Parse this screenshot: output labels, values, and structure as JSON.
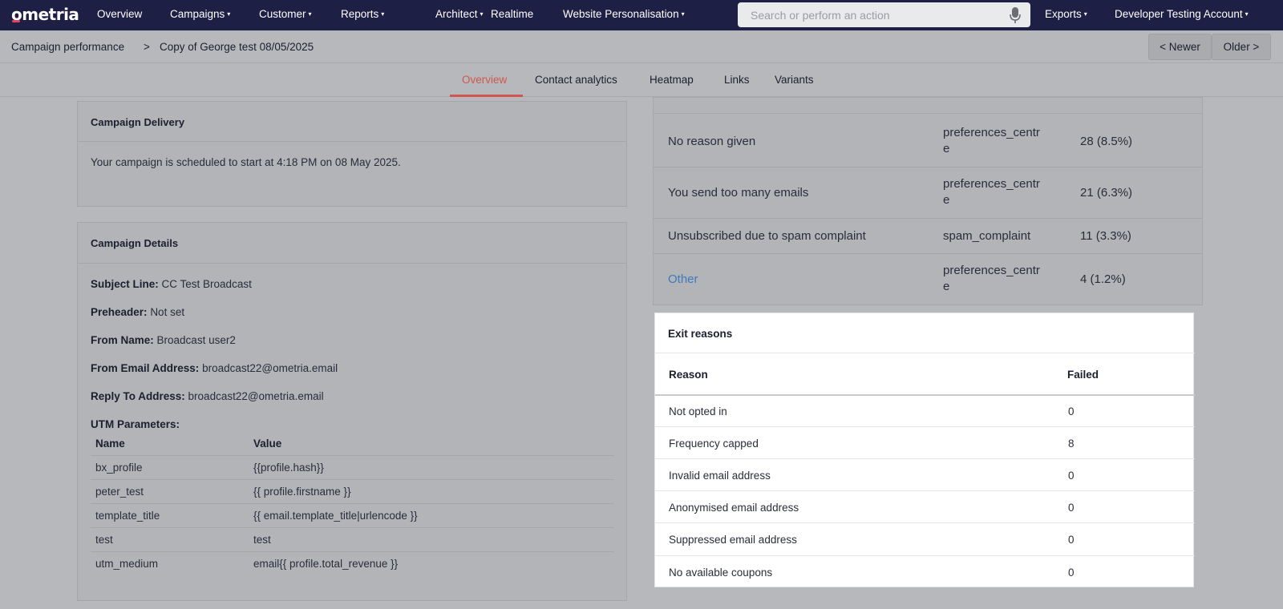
{
  "app": {
    "logo_text": "ometria"
  },
  "nav": {
    "items": [
      {
        "label": "Overview",
        "dropdown": false
      },
      {
        "label": "Campaigns",
        "dropdown": true
      },
      {
        "label": "Customer",
        "dropdown": true
      },
      {
        "label": "Reports",
        "dropdown": true
      },
      {
        "label": "Architect",
        "dropdown": true
      },
      {
        "label": "Realtime",
        "dropdown": false
      },
      {
        "label": "Website Personalisation",
        "dropdown": true
      }
    ],
    "search_placeholder": "Search or perform an action",
    "exports_label": "Exports",
    "account_label": "Developer Testing Account",
    "caret": "▾"
  },
  "breadcrumb": {
    "parent": "Campaign performance",
    "separator": ">",
    "current": "Copy of George test 08/05/2025"
  },
  "pager": {
    "newer": "< Newer",
    "older": "Older >"
  },
  "tabs": [
    {
      "label": "Overview",
      "active": true
    },
    {
      "label": "Contact analytics",
      "active": false
    },
    {
      "label": "Heatmap",
      "active": false
    },
    {
      "label": "Links",
      "active": false
    },
    {
      "label": "Variants",
      "active": false
    }
  ],
  "delivery": {
    "title": "Campaign Delivery",
    "message": "Your campaign is scheduled to start at 4:18 PM on 08 May 2025."
  },
  "details": {
    "title": "Campaign Details",
    "fields": [
      {
        "label": "Subject Line:",
        "value": "CC Test Broadcast"
      },
      {
        "label": "Preheader:",
        "value": "Not set"
      },
      {
        "label": "From Name:",
        "value": "Broadcast user2"
      },
      {
        "label": "From Email Address:",
        "value": "broadcast22@ometria.email"
      },
      {
        "label": "Reply To Address:",
        "value": "broadcast22@ometria.email"
      }
    ],
    "utm_label": "UTM Parameters:",
    "utm_headers": {
      "name": "Name",
      "value": "Value"
    },
    "utm_rows": [
      {
        "name": "bx_profile",
        "value": "{{profile.hash}}"
      },
      {
        "name": "peter_test",
        "value": "{{ profile.firstname }}"
      },
      {
        "name": "template_title",
        "value": "{{ email.template_title|urlencode }}"
      },
      {
        "name": "test",
        "value": "test"
      },
      {
        "name": "utm_medium",
        "value": "email{{ profile.total_revenue }}"
      }
    ]
  },
  "unsubscribe_reasons": {
    "rows": [
      {
        "reason": "No reason given",
        "source_line1": "preferences_centr",
        "source_line2": "e",
        "count": "28 (8.5%)",
        "link": false
      },
      {
        "reason": "You send too many emails",
        "source_line1": "preferences_centr",
        "source_line2": "e",
        "count": "21 (6.3%)",
        "link": false
      },
      {
        "reason": "Unsubscribed due to spam complaint",
        "source_line1": "spam_complaint",
        "source_line2": "",
        "count": "11 (3.3%)",
        "link": false
      },
      {
        "reason": "Other",
        "source_line1": "preferences_centr",
        "source_line2": "e",
        "count": "4 (1.2%)",
        "link": true
      }
    ]
  },
  "exit_reasons": {
    "title": "Exit reasons",
    "headers": {
      "reason": "Reason",
      "failed": "Failed"
    },
    "rows": [
      {
        "reason": "Not opted in",
        "failed": "0"
      },
      {
        "reason": "Frequency capped",
        "failed": "8"
      },
      {
        "reason": "Invalid email address",
        "failed": "0"
      },
      {
        "reason": "Anonymised email address",
        "failed": "0"
      },
      {
        "reason": "Suppressed email address",
        "failed": "0"
      },
      {
        "reason": "No available coupons",
        "failed": "0"
      }
    ]
  },
  "colors": {
    "nav_bg": "#1d1f44",
    "accent_tab": "#d0574f",
    "link": "#3d7bbf",
    "logo_dot": "#e8425a"
  }
}
